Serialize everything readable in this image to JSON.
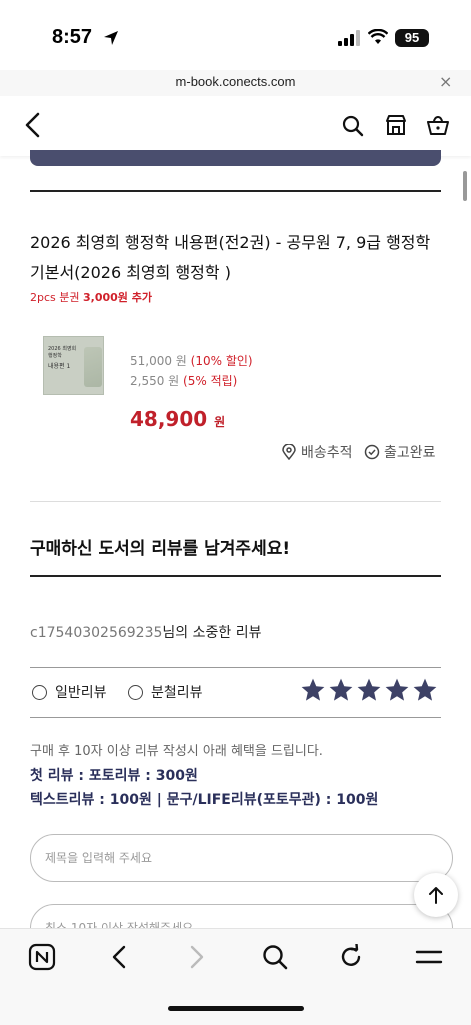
{
  "status_bar": {
    "time": "8:57",
    "battery": "95"
  },
  "browser": {
    "url": "m-book.conects.com",
    "close": "×"
  },
  "header": {
    "back_icon": "chevron-left-icon",
    "icons": [
      "search-icon",
      "store-icon",
      "basket-icon"
    ]
  },
  "order": {
    "title": "2026 최영희 행정학 내용편(전2권) - 공무원 7, 9급 행정학 기본서(2026 최영희 행정학 )",
    "extra_prefix": "2pcs 분권 ",
    "extra_amount": "3,000원 추가",
    "book_cover_title": "2026 최영희 행정학",
    "book_cover_sub": "내용편 1",
    "list_price": "51,000 원",
    "discount": "(10% 할인)",
    "points": "2,550 원",
    "points_rate": "(5% 적립)",
    "final_price": "48,900",
    "final_unit": "원",
    "track_label": "배송추적",
    "shipped_label": "출고완료"
  },
  "review": {
    "heading": "구매하신 도서의 리뷰를 남겨주세요!",
    "user_id": "c17540302569235",
    "user_suffix": "님의 소중한 리뷰",
    "type_general": "일반리뷰",
    "type_split": "분철리뷰",
    "rating": 5,
    "star_color": "#3d4166",
    "benefit_note": "구매 후 10자 이상 리뷰 작성시 아래 혜택을 드립니다.",
    "benefit_line1": "첫 리뷰 : 포토리뷰 : 300원",
    "benefit_line2": "텍스트리뷰 : 100원  |  문구/LIFE리뷰(포토무관) : 100원",
    "title_placeholder": "제목을 입력해 주세요",
    "content_placeholder": "최소 10자 이상 작성해주세요"
  },
  "bottom_nav": [
    "naver-home-icon",
    "back-icon",
    "forward-icon",
    "search-icon",
    "refresh-icon",
    "menu-icon"
  ]
}
